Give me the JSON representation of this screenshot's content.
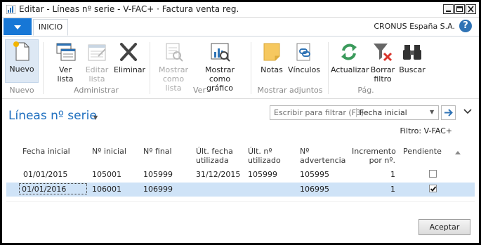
{
  "window": {
    "title": "Editar - Líneas nº serie - V-FAC+ · Factura venta reg."
  },
  "menubar": {
    "tab_inicio": "INICIO",
    "company": "CRONUS España S.A.",
    "help": "?"
  },
  "ribbon": {
    "buttons": {
      "nuevo": "Nuevo",
      "ver_lista_1": "Ver",
      "ver_lista_2": "lista",
      "editar_lista_1": "Editar",
      "editar_lista_2": "lista",
      "eliminar": "Eliminar",
      "mostrar_lista_1": "Mostrar",
      "mostrar_lista_2": "como lista",
      "mostrar_grafico_1": "Mostrar como",
      "mostrar_grafico_2": "gráfico",
      "notas": "Notas",
      "vinculos": "Vínculos",
      "actualizar": "Actualizar",
      "borrar_filtro_1": "Borrar",
      "borrar_filtro_2": "filtro",
      "buscar": "Buscar"
    },
    "groups": {
      "nuevo": "Nuevo",
      "administrar": "Administrar",
      "ver": "Ver",
      "mostrar_adjuntos": "Mostrar adjuntos",
      "pag": "Pág."
    }
  },
  "page": {
    "title": "Líneas nº serie",
    "filter_placeholder": "Escribir para filtrar (F3)",
    "filter_field": "Fecha inicial",
    "filter_text": "Filtro: V-FAC+"
  },
  "table": {
    "headers": {
      "fecha_inicial": "Fecha inicial",
      "no_inicial": "Nº inicial",
      "no_final": "Nº final",
      "ult_fecha_1": "Últ. fecha",
      "ult_fecha_2": "utilizada",
      "ult_no_1": "Últ. nº",
      "ult_no_2": "utilizado",
      "no_adv_1": "Nº",
      "no_adv_2": "advertencia",
      "incremento_1": "Incremento",
      "incremento_2": "por nº.",
      "pendiente": "Pendiente"
    },
    "rows": [
      {
        "fecha_inicial": "01/01/2015",
        "no_inicial": "105001",
        "no_final": "105999",
        "ult_fecha": "31/12/2015",
        "ult_no": "105999",
        "no_adv": "105995",
        "incremento": "1",
        "pendiente": false
      },
      {
        "fecha_inicial": "01/01/2016",
        "no_inicial": "106001",
        "no_final": "106999",
        "ult_fecha": "",
        "ult_no": "",
        "no_adv": "106995",
        "incremento": "1",
        "pendiente": true
      }
    ]
  },
  "footer": {
    "aceptar": "Aceptar"
  },
  "colors": {
    "accent": "#1777d6",
    "title_blue": "#1e6fbf",
    "selected_row": "#cfe3f7"
  }
}
